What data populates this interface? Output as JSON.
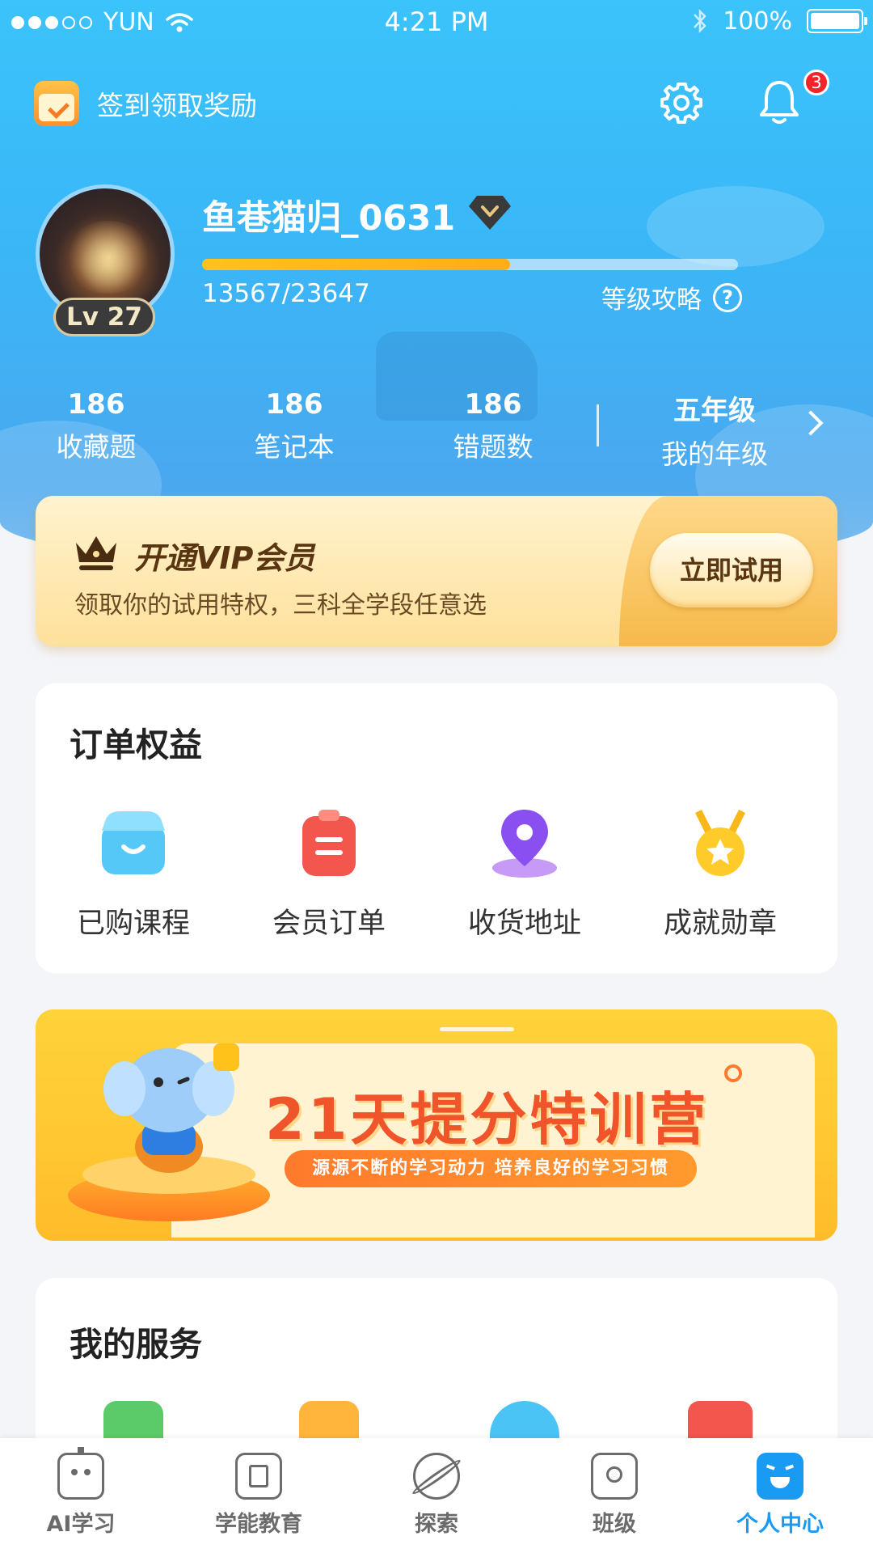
{
  "status_bar": {
    "carrier": "YUN",
    "time": "4:21 PM",
    "battery": "100%"
  },
  "header": {
    "checkin_label": "签到领取奖励",
    "notification_count": "3"
  },
  "profile": {
    "username": "鱼巷猫归_0631",
    "level": "Lv 27",
    "xp_text": "13567/23647",
    "xp_progress": 0.574,
    "level_guide": "等级攻略",
    "help_mark": "?"
  },
  "stats": [
    {
      "value": "186",
      "label": "收藏题"
    },
    {
      "value": "186",
      "label": "笔记本"
    },
    {
      "value": "186",
      "label": "错题数"
    },
    {
      "value": "五年级",
      "label": "我的年级"
    }
  ],
  "vip": {
    "title": "开通VIP会员",
    "subtitle": "领取你的试用特权，三科全学段任意选",
    "button": "立即试用"
  },
  "orders": {
    "title": "订单权益",
    "items": [
      {
        "label": "已购课程",
        "icon": "shop-icon"
      },
      {
        "label": "会员订单",
        "icon": "clipboard-icon"
      },
      {
        "label": "收货地址",
        "icon": "location-pin-icon"
      },
      {
        "label": "成就勋章",
        "icon": "medal-icon"
      }
    ]
  },
  "banner": {
    "headline": "21天提分特训营",
    "tagline": "源源不断的学习动力   培养良好的学习习惯"
  },
  "services": {
    "title": "我的服务"
  },
  "tabs": [
    {
      "label": "AI学习",
      "icon": "robot-icon"
    },
    {
      "label": "学能教育",
      "icon": "book-icon"
    },
    {
      "label": "探索",
      "icon": "planet-icon"
    },
    {
      "label": "班级",
      "icon": "classroom-icon"
    },
    {
      "label": "个人中心",
      "icon": "face-icon",
      "active": true
    }
  ],
  "colors": {
    "hero_blue": "#3bc3fb",
    "accent_blue": "#1a9bf3",
    "vip_gold": "#ffd88a",
    "xp_orange": "#ffb916",
    "badge_red": "#f3232a"
  }
}
